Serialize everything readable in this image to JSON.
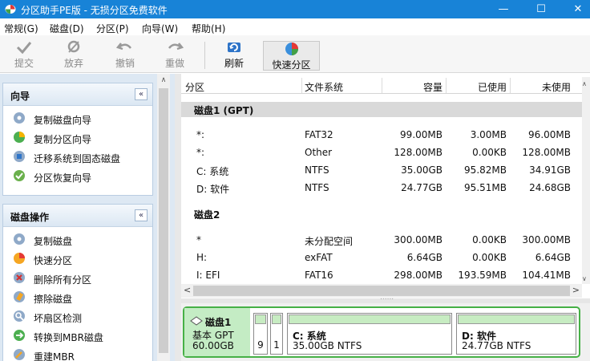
{
  "window": {
    "title": "分区助手PE版 - 无损分区免费软件",
    "minimize": "—",
    "maximize": "☐",
    "close": "✕"
  },
  "menu": [
    "常规(G)",
    "磁盘(D)",
    "分区(P)",
    "向导(W)",
    "帮助(H)"
  ],
  "toolbar": {
    "submit": "提交",
    "discard": "放弃",
    "undo": "撤销",
    "redo": "重做",
    "refresh": "刷新",
    "quick_partition": "快速分区"
  },
  "wizard": {
    "title": "向导",
    "collapse": "«",
    "items": [
      "复制磁盘向导",
      "复制分区向导",
      "迁移系统到固态磁盘",
      "分区恢复向导"
    ]
  },
  "disk_ops": {
    "title": "磁盘操作",
    "collapse": "«",
    "items": [
      "复制磁盘",
      "快速分区",
      "删除所有分区",
      "擦除磁盘",
      "坏扇区检测",
      "转换到MBR磁盘",
      "重建MBR"
    ]
  },
  "table": {
    "columns": [
      "分区",
      "文件系统",
      "容量",
      "已使用",
      "未使用"
    ],
    "disk1": {
      "name": "磁盘1 (GPT)",
      "rows": [
        [
          "*:",
          "FAT32",
          "99.00MB",
          "3.00MB",
          "96.00MB"
        ],
        [
          "*:",
          "Other",
          "128.00MB",
          "0.00KB",
          "128.00MB"
        ],
        [
          "C: 系统",
          "NTFS",
          "35.00GB",
          "95.82MB",
          "34.91GB"
        ],
        [
          "D: 软件",
          "NTFS",
          "24.77GB",
          "95.51MB",
          "24.68GB"
        ]
      ]
    },
    "disk2": {
      "name": "磁盘2",
      "rows": [
        [
          "*",
          "未分配空间",
          "300.00MB",
          "0.00KB",
          "300.00MB"
        ],
        [
          "H:",
          "exFAT",
          "6.64GB",
          "0.00KB",
          "6.64GB"
        ],
        [
          "I: EFI",
          "FAT16",
          "298.00MB",
          "193.59MB",
          "104.41MB"
        ]
      ]
    }
  },
  "scroll": {
    "left": "<",
    "right": ">",
    "up": "∧",
    "down": "∨",
    "grip": "......"
  },
  "diskmap": {
    "disk_name": "磁盘1",
    "disk_type": "基本 GPT",
    "disk_size": "60.00GB",
    "small_parts": [
      "9",
      "1"
    ],
    "c_label": "C: 系统",
    "c_detail": "35.00GB NTFS",
    "d_label": "D: 软件",
    "d_detail": "24.77GB NTFS"
  },
  "colors": {
    "titlebar": "#1883d7",
    "disk_green": "#46b046",
    "panel_blue": "#dde8f3"
  }
}
